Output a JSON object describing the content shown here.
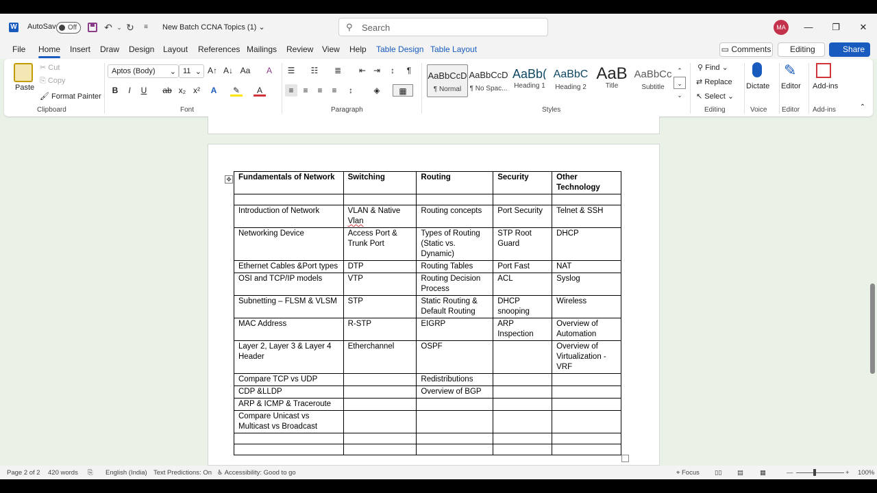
{
  "titlebar": {
    "autosave_label": "AutoSave",
    "autosave_state": "Off",
    "doc_title": "New Batch CCNA Topics (1)",
    "search_placeholder": "Search",
    "avatar_initials": "MA"
  },
  "menu": {
    "tabs": [
      "File",
      "Home",
      "Insert",
      "Draw",
      "Design",
      "Layout",
      "References",
      "Mailings",
      "Review",
      "View",
      "Help",
      "Table Design",
      "Table Layout"
    ],
    "active_tab": "Home",
    "comments_label": "Comments",
    "editing_label": "Editing",
    "share_label": "Share"
  },
  "ribbon": {
    "clipboard": {
      "paste": "Paste",
      "cut": "Cut",
      "copy": "Copy",
      "format_painter": "Format Painter",
      "label": "Clipboard"
    },
    "font": {
      "name": "Aptos (Body)",
      "size": "11",
      "label": "Font"
    },
    "paragraph": {
      "label": "Paragraph"
    },
    "styles": {
      "label": "Styles",
      "items": [
        {
          "preview": "AaBbCcD",
          "name": "¶ Normal"
        },
        {
          "preview": "AaBbCcD",
          "name": "¶ No Spac..."
        },
        {
          "preview": "AaBb(",
          "name": "Heading 1"
        },
        {
          "preview": "AaBbC",
          "name": "Heading 2"
        },
        {
          "preview": "AaB",
          "name": "Title"
        },
        {
          "preview": "AaBbCc",
          "name": "Subtitle"
        }
      ]
    },
    "editing": {
      "find": "Find",
      "replace": "Replace",
      "select": "Select",
      "label": "Editing"
    },
    "voice": {
      "dictate": "Dictate",
      "label": "Voice"
    },
    "editor": {
      "editor": "Editor",
      "label": "Editor"
    },
    "addins": {
      "addins": "Add-ins",
      "label": "Add-ins"
    }
  },
  "table": {
    "headers": [
      "Fundamentals of Network",
      "Switching",
      "Routing",
      "Security",
      "Other Technology"
    ],
    "rows": [
      [
        "",
        "",
        "",
        "",
        ""
      ],
      [
        "Introduction of Network",
        "VLAN & Native Vlan",
        "Routing concepts",
        "Port Security",
        "Telnet & SSH"
      ],
      [
        "Networking Device",
        "Access Port & Trunk Port",
        "Types of Routing (Static vs. Dynamic)",
        "STP Root Guard",
        "DHCP"
      ],
      [
        "Ethernet Cables &Port types",
        "DTP",
        "Routing Tables",
        "Port Fast",
        "NAT"
      ],
      [
        "OSI and TCP/IP models",
        "VTP",
        "Routing Decision Process",
        "ACL",
        "Syslog"
      ],
      [
        "Subnetting – FLSM & VLSM",
        "STP",
        "Static Routing & Default Routing",
        "DHCP snooping",
        "Wireless"
      ],
      [
        "MAC Address",
        "R-STP",
        "EIGRP",
        "ARP Inspection",
        "Overview of Automation"
      ],
      [
        "Layer 2, Layer 3 & Layer 4 Header",
        "Etherchannel",
        "OSPF",
        "",
        "Overview of Virtualization - VRF"
      ],
      [
        "Compare TCP vs UDP",
        "",
        "Redistributions",
        "",
        ""
      ],
      [
        "CDP &LLDP",
        "",
        "Overview of BGP",
        "",
        ""
      ],
      [
        "ARP & ICMP & Traceroute",
        "",
        "",
        "",
        ""
      ],
      [
        "Compare Unicast vs Multicast vs Broadcast",
        "",
        "",
        "",
        ""
      ],
      [
        "",
        "",
        "",
        "",
        ""
      ],
      [
        "",
        "",
        "",
        "",
        ""
      ]
    ]
  },
  "status": {
    "page": "Page 2 of 2",
    "words": "420 words",
    "language": "English (India)",
    "predictions": "Text Predictions: On",
    "accessibility": "Accessibility: Good to go",
    "focus": "Focus",
    "zoom": "100%"
  }
}
